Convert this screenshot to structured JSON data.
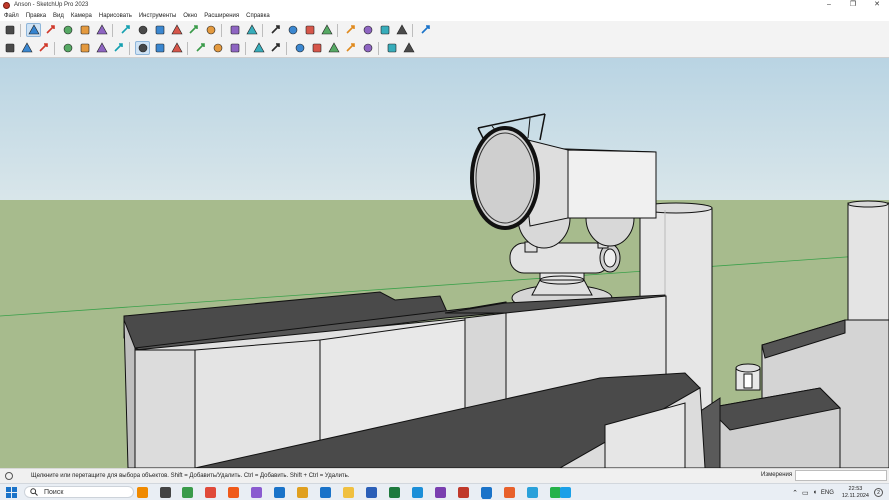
{
  "window": {
    "title": "Anson - SketchUp Pro 2023",
    "controls": [
      "–",
      "❐",
      "✕"
    ]
  },
  "menu": [
    "Файл",
    "Правка",
    "Вид",
    "Камера",
    "Нарисовать",
    "Инструменты",
    "Окно",
    "Расширения",
    "Справка"
  ],
  "toolbar1": [
    {
      "name": "zoom-icon",
      "active": false
    },
    {
      "sep": true
    },
    {
      "name": "select-arrow-icon",
      "active": true
    },
    {
      "name": "eraser-icon",
      "active": false
    },
    {
      "name": "pencil-line-icon",
      "active": false
    },
    {
      "name": "arc-icon",
      "active": false
    },
    {
      "name": "rectangle-icon",
      "active": false
    },
    {
      "sep": true
    },
    {
      "name": "push-pull-icon",
      "active": false
    },
    {
      "name": "follow-me-icon",
      "active": false
    },
    {
      "name": "move-icon",
      "active": false
    },
    {
      "name": "rotate-icon",
      "active": false
    },
    {
      "name": "scale-icon",
      "active": false
    },
    {
      "name": "offset-icon",
      "active": false
    },
    {
      "sep": true
    },
    {
      "name": "tape-measure-icon",
      "active": false
    },
    {
      "name": "paint-bucket-icon",
      "active": false
    },
    {
      "sep": true
    },
    {
      "name": "orbit-icon",
      "active": false
    },
    {
      "name": "pan-icon",
      "active": false
    },
    {
      "name": "zoom-window-icon",
      "active": false
    },
    {
      "name": "zoom-extents-icon",
      "active": false
    },
    {
      "sep": true
    },
    {
      "name": "warehouse-icon",
      "active": false
    },
    {
      "name": "extension-icon",
      "active": false
    },
    {
      "name": "layout-icon",
      "active": false
    },
    {
      "name": "style-builder-icon",
      "active": false
    },
    {
      "sep": true
    },
    {
      "name": "account-icon",
      "active": false
    }
  ],
  "toolbar2": [
    {
      "name": "open-folder-icon",
      "active": false
    },
    {
      "name": "gear-icon",
      "active": false
    },
    {
      "name": "cancel-icon",
      "active": false
    },
    {
      "sep": true
    },
    {
      "name": "xray-icon",
      "active": false
    },
    {
      "name": "back-edges-icon",
      "active": false
    },
    {
      "name": "wireframe-icon",
      "active": false
    },
    {
      "name": "hidden-line-icon",
      "active": false
    },
    {
      "sep": true
    },
    {
      "name": "shaded-icon",
      "active": true
    },
    {
      "name": "shaded-textures-icon",
      "active": false
    },
    {
      "name": "monochrome-icon",
      "active": false
    },
    {
      "sep": true
    },
    {
      "name": "cloud-upload-icon",
      "active": false
    },
    {
      "name": "cloud-download-icon",
      "active": false
    },
    {
      "name": "cloud-sync-icon",
      "active": false
    },
    {
      "sep": true
    },
    {
      "name": "point-icon",
      "active": false
    },
    {
      "name": "guide-line-icon",
      "active": false
    },
    {
      "sep": true
    },
    {
      "name": "iso-view-icon",
      "active": false
    },
    {
      "name": "top-view-icon",
      "active": false
    },
    {
      "name": "front-view-icon",
      "active": false
    },
    {
      "name": "right-view-icon",
      "active": false
    },
    {
      "name": "back-view-icon",
      "active": false
    },
    {
      "sep": true
    },
    {
      "name": "cloud-left-icon",
      "active": false
    },
    {
      "name": "cloud-right-icon",
      "active": false
    }
  ],
  "status": {
    "hint": "Щелкните или перетащите для выбора объектов. Shift = Добавить/Удалить. Ctrl = Добавить. Shift + Ctrl = Удалить.",
    "measurements_label": "Измерения"
  },
  "taskbar": {
    "search_placeholder": "Поиск",
    "apps": [
      "vlc-icon",
      "taskview-icon",
      "refresh-app-icon",
      "chrome-icon",
      "brave-icon",
      "app-icon",
      "app-icon",
      "app-icon",
      "outlook-icon",
      "explorer-icon",
      "word-icon",
      "excel-icon",
      "edge-icon",
      "onenote-icon",
      "app-icon",
      "sketchup-icon",
      "firefox-icon",
      "telegram-icon",
      "whatsapp-icon",
      "skype-icon"
    ],
    "lang": "ENG",
    "time": "22:53",
    "date": "12.11.2024",
    "notification_count": "2"
  },
  "colors": {
    "sky": "#c7dde9",
    "ground": "#a6ba8c",
    "accent": "#1a73c9"
  }
}
